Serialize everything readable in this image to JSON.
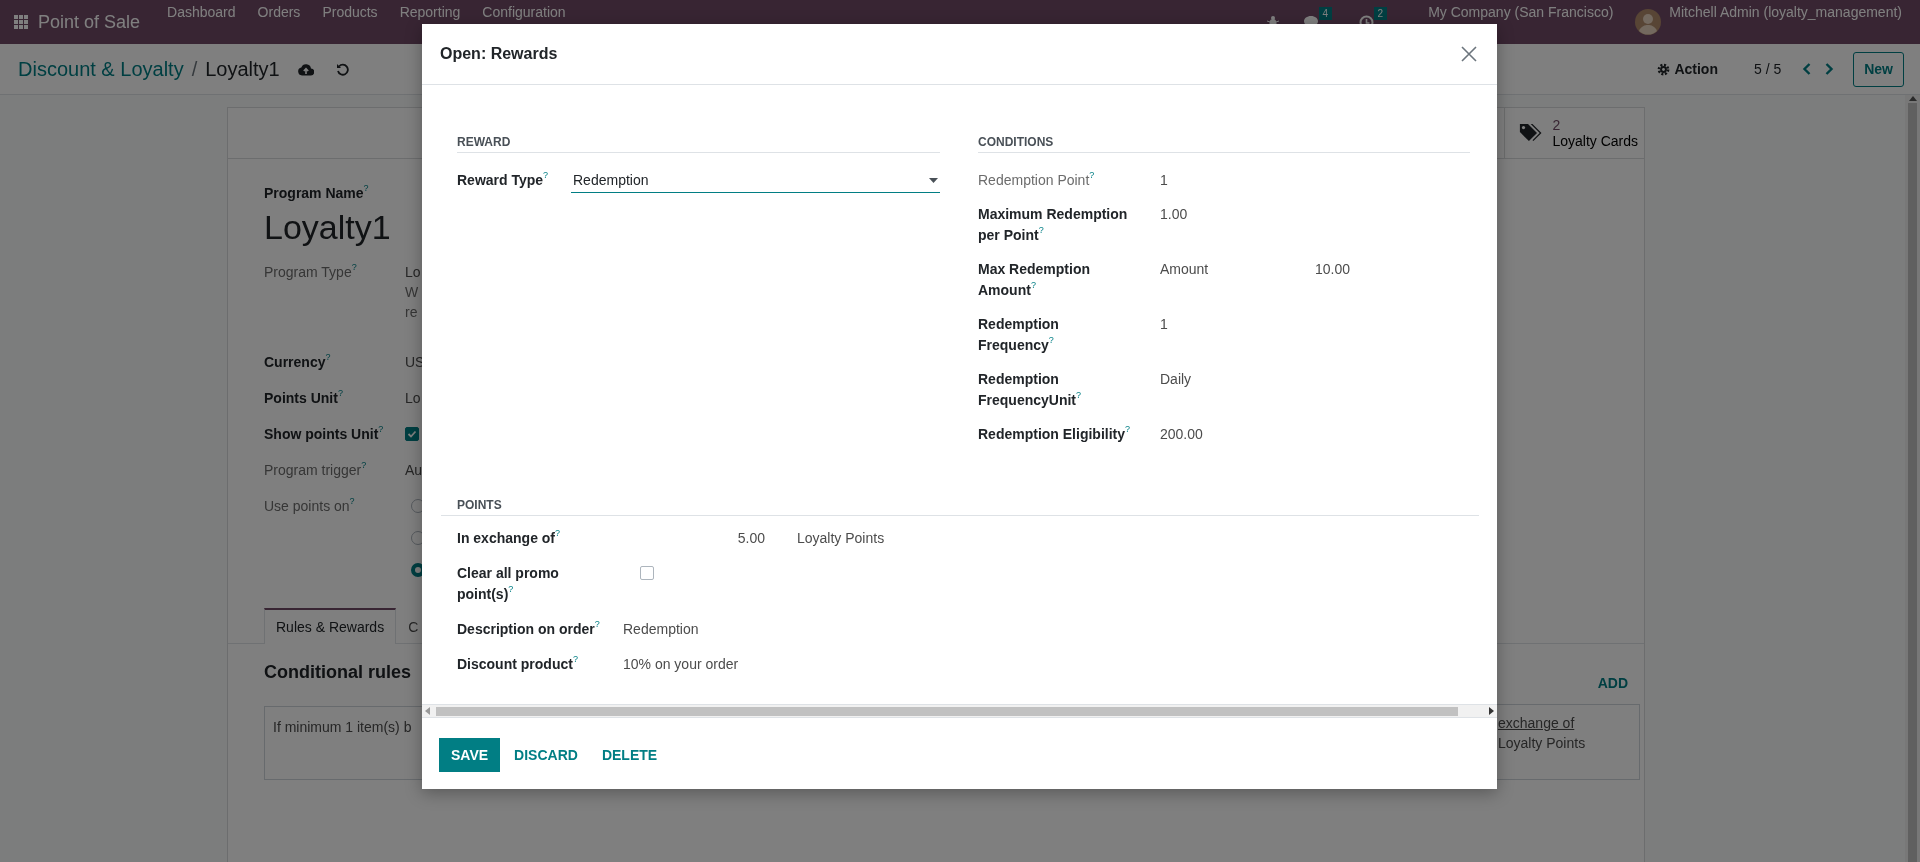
{
  "navbar": {
    "app_name": "Point of Sale",
    "menu": [
      "Dashboard",
      "Orders",
      "Products",
      "Reporting",
      "Configuration"
    ],
    "chat_count": "4",
    "activity_count": "2",
    "company": "My Company (San Francisco)",
    "user": "Mitchell Admin (loyalty_management)"
  },
  "control_panel": {
    "breadcrumb": [
      {
        "label": "Discount & Loyalty",
        "current": false
      },
      {
        "label": "Loyalty1",
        "current": true
      }
    ],
    "separator": "/",
    "action": "Action",
    "pager": "5 / 5",
    "new_button": "New"
  },
  "form": {
    "stat_button": {
      "value": "2",
      "label": "Loyalty Cards"
    },
    "program_name_label": "Program Name$^{?}$",
    "program_name": "Loyalty1",
    "fields": [
      {
        "kind": "text",
        "label": "Program Type$^{?}$",
        "required": false,
        "value": "Lo",
        "description": [
          "W",
          "re"
        ]
      },
      {
        "kind": "text",
        "label": "Currency$^{?}$",
        "required": true,
        "value": "US"
      },
      {
        "kind": "text",
        "label": "Points Unit$^{?}$",
        "required": true,
        "value": "Lo"
      },
      {
        "kind": "checkbox",
        "label": "Show points Unit$^{?}$",
        "required": true,
        "checked": true
      },
      {
        "kind": "text",
        "label": "Program trigger$^{?}$",
        "required": false,
        "value": "Au"
      },
      {
        "kind": "radio",
        "label": "Use points on$^{?}$",
        "required": false,
        "options": [
          {
            "selected": false
          },
          {
            "selected": false
          },
          {
            "selected": true
          }
        ]
      }
    ],
    "tabs": [
      {
        "label": "Rules & Rewards",
        "selected": true
      },
      {
        "label": "C",
        "selected": false
      }
    ],
    "conditional_rules": {
      "title": "Conditional rules",
      "card_text": "If minimum 1 item(s) b"
    },
    "rewards": {
      "add_label": "ADD",
      "card_link": "exchange of",
      "card_text": "Loyalty Points"
    }
  },
  "dialog": {
    "title": "Open: Rewards",
    "reward": {
      "heading": "REWARD",
      "label": "Reward Type$^{?}$",
      "value": "Redemption"
    },
    "conditions": {
      "heading": "CONDITIONS",
      "fields": [
        {
          "label": "Redemption Point$^{?}$",
          "required": false,
          "values": [
            "1"
          ]
        },
        {
          "label": "Maximum Redemption per Point$^{?}$",
          "required": true,
          "values": [
            "1.00"
          ]
        },
        {
          "label": "Max Redemption Amount$^{?}$",
          "required": true,
          "values": [
            "Amount",
            "10.00"
          ]
        },
        {
          "label": "Redemption Frequency$^{?}$",
          "required": true,
          "values": [
            "1"
          ]
        },
        {
          "label": "Redemption FrequencyUnit$^{?}$",
          "required": true,
          "values": [
            "Daily"
          ]
        },
        {
          "label": "Redemption Eligibility$^{?}$",
          "required": true,
          "values": [
            "200.00"
          ]
        }
      ]
    },
    "points": {
      "heading": "POINTS",
      "exchange_label": "In exchange of$^{?}$",
      "exchange_amount": "5.00",
      "exchange_unit": "Loyalty Points",
      "clear_label": "Clear all promo point(s)$^{?}$",
      "clear_checked": false,
      "description_label": "Description on order$^{?}$",
      "description_value": "Redemption",
      "product_label": "Discount product$^{?}$",
      "product_value": "10% on your order"
    },
    "buttons": [
      {
        "label": "SAVE",
        "primary": true
      },
      {
        "label": "DISCARD",
        "primary": false
      },
      {
        "label": "DELETE",
        "primary": false
      }
    ]
  }
}
